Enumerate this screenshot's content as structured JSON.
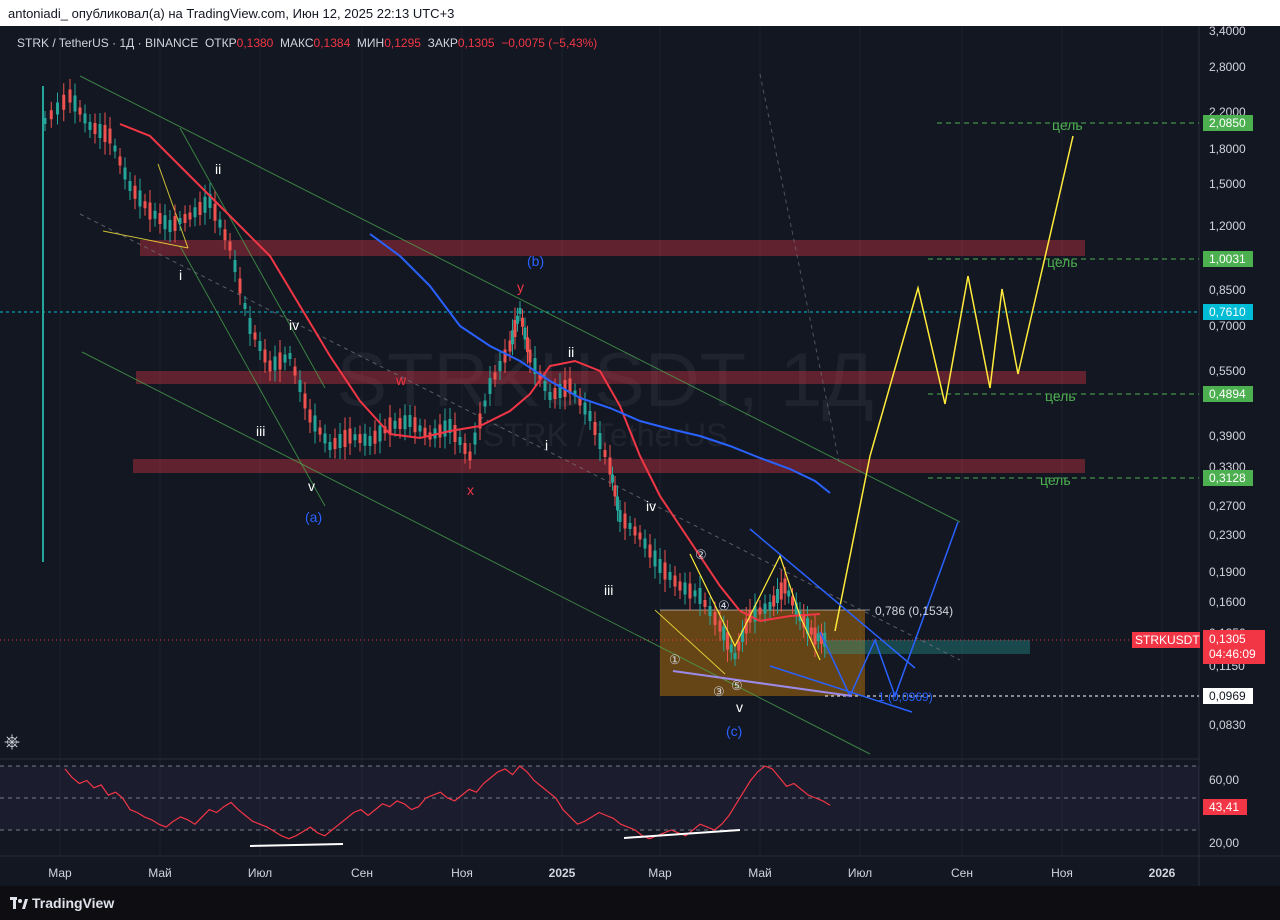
{
  "header": {
    "publisher_line": "antoniadi_ опубликовал(а) на TradingView.com, Июн 12, 2025 22:13 UTC+3"
  },
  "legend": {
    "symbol_line": "STRK / TetherUS · 1Д · BINANCE",
    "open_label": "ОТКР",
    "open_value": "0,1380",
    "high_label": "МАКС",
    "high_value": "0,1384",
    "low_label": "МИН",
    "low_value": "0,1295",
    "close_label": "ЗАКР",
    "close_value": "0,1305",
    "change": "−0,0075 (−5,43%)"
  },
  "watermark": {
    "main": "STRKUSDT, 1Д",
    "sub": "STRK / TetherUS"
  },
  "chart_data": {
    "type": "line",
    "scale": "log",
    "y_ticks": [
      "3,4000",
      "2,8000",
      "2,2000",
      "1,8000",
      "1,5000",
      "1,2000",
      "0,8500",
      "0,7000",
      "0,5500",
      "0,3900",
      "0,3300",
      "0,2700",
      "0,2300",
      "0,1900",
      "0,1600",
      "0,1350",
      "0,1150",
      "0,0830"
    ],
    "x_ticks": [
      "Мар",
      "Май",
      "Июл",
      "Сен",
      "Ноя",
      "2025",
      "Мар",
      "Май",
      "Июл",
      "Сен",
      "Ноя",
      "2026"
    ],
    "price_labels": [
      {
        "text": "2,0850",
        "color": "#4caf50"
      },
      {
        "text": "1,0031",
        "color": "#4caf50"
      },
      {
        "text": "0,7610",
        "color": "#00bcd4"
      },
      {
        "text": "0,4894",
        "color": "#4caf50"
      },
      {
        "text": "0,3128",
        "color": "#4caf50"
      },
      {
        "text": "0,0969",
        "color": "#ffffff"
      }
    ],
    "current_price": {
      "symbol": "STRKUSDT",
      "value": "0,1305",
      "countdown": "04:46:09"
    },
    "target_labels": [
      "цель",
      "цель",
      "цель",
      "цель"
    ],
    "fib_label": "0,786 (0,1534)",
    "fib_label_low": "1 (0,0969)",
    "wave_labels": [
      {
        "text": "i",
        "color": "#ffffff"
      },
      {
        "text": "ii",
        "color": "#ffffff"
      },
      {
        "text": "iii",
        "color": "#ffffff"
      },
      {
        "text": "iv",
        "color": "#ffffff"
      },
      {
        "text": "v",
        "color": "#ffffff"
      },
      {
        "text": "(a)",
        "color": "#2962ff"
      },
      {
        "text": "w",
        "color": "#f23645"
      },
      {
        "text": "x",
        "color": "#f23645"
      },
      {
        "text": "y",
        "color": "#f23645"
      },
      {
        "text": "(b)",
        "color": "#2962ff"
      },
      {
        "text": "i",
        "color": "#ffffff"
      },
      {
        "text": "ii",
        "color": "#ffffff"
      },
      {
        "text": "iii",
        "color": "#ffffff"
      },
      {
        "text": "iv",
        "color": "#ffffff"
      },
      {
        "text": "v",
        "color": "#ffffff"
      },
      {
        "text": "(c)",
        "color": "#2962ff"
      }
    ],
    "circled_labels": [
      "①",
      "②",
      "③",
      "④",
      "⑤"
    ],
    "rsi": {
      "value": "43,41",
      "ticks": [
        "60,00",
        "20,00"
      ],
      "values": [
        68,
        62,
        58,
        60,
        55,
        57,
        50,
        52,
        48,
        40,
        38,
        35,
        33,
        30,
        28,
        32,
        35,
        33,
        30,
        35,
        40,
        38,
        42,
        45,
        40,
        36,
        32,
        30,
        28,
        25,
        22,
        20,
        22,
        25,
        28,
        24,
        22,
        26,
        30,
        34,
        38,
        40,
        36,
        40,
        44,
        42,
        46,
        44,
        40,
        42,
        48,
        50,
        52,
        48,
        46,
        50,
        54,
        52,
        58,
        62,
        66,
        68,
        64,
        70,
        66,
        60,
        56,
        52,
        48,
        40,
        35,
        30,
        32,
        35,
        38,
        36,
        34,
        30,
        28,
        26,
        22,
        20,
        22,
        24,
        26,
        24,
        22,
        26,
        30,
        28,
        26,
        30,
        36,
        44,
        52,
        60,
        66,
        70,
        68,
        62,
        56,
        58,
        54,
        50,
        48,
        46,
        43
      ]
    }
  }
}
